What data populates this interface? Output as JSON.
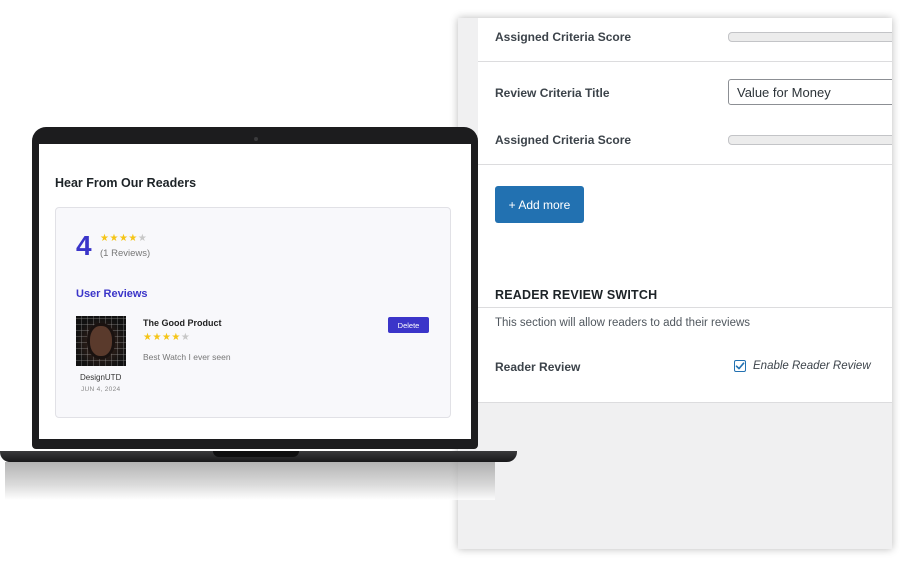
{
  "admin": {
    "assigned_score_label_1": "Assigned Criteria Score",
    "review_title_label": "Review Criteria Title",
    "review_title_value": "Value for Money",
    "assigned_score_label_2": "Assigned Criteria Score",
    "add_more_label": "+ Add more",
    "section_heading": "READER REVIEW SWITCH",
    "section_description": "This section will allow readers to add their reviews",
    "reader_review_label": "Reader Review",
    "enable_reader_review_label": "Enable Reader Review",
    "enable_reader_review_checked": true,
    "button_color": "#2271b1"
  },
  "preview": {
    "heading": "Hear From Our Readers",
    "average_score": "4",
    "average_stars": 4,
    "max_stars": 5,
    "reviews_count_text": "(1 Reviews)",
    "user_reviews_heading": "User Reviews",
    "accent_color": "#3b35c9",
    "reviews": [
      {
        "reviewer": "DesignUTD",
        "date": "JUN 4, 2024",
        "title": "The Good Product",
        "stars": 4,
        "text": "Best Watch I ever seen",
        "delete_label": "Delete"
      }
    ]
  }
}
